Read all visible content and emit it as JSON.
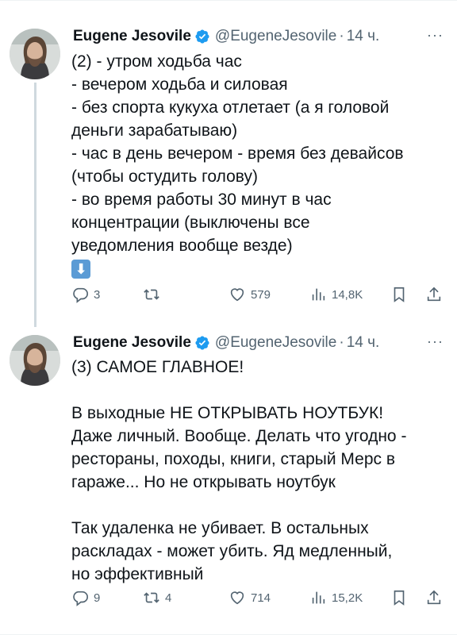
{
  "tweets": [
    {
      "author": {
        "name": "Eugene Jesovile",
        "handle": "@EugeneJesovile",
        "time": "14 ч."
      },
      "lines": [
        "(2) - утром ходьба час",
        "- вечером ходьба и силовая",
        "- без спорта кукуха отлетает (а я головой",
        "деньги зарабатываю)",
        "- час в день вечером - время без девайсов",
        "(чтобы остудить голову)",
        "- во время работы 30 минут в час",
        "концентрации (выключены все",
        "уведомления вообще везде)"
      ],
      "emoji": "⬇",
      "stats": {
        "replies": "3",
        "retweets": "",
        "likes": "579",
        "views": "14,8K"
      }
    },
    {
      "author": {
        "name": "Eugene Jesovile",
        "handle": "@EugeneJesovile",
        "time": "14 ч."
      },
      "lines": [
        "(3) САМОЕ ГЛАВНОЕ!",
        "",
        "В выходные НЕ ОТКРЫВАТЬ НОУТБУК!",
        "Даже личный. Вообще. Делать что угодно -",
        "рестораны, походы, книги, старый Мерс в",
        "гараже... Но не открывать ноутбук",
        "",
        "Так удаленка не убивает. В остальных",
        "раскладах - может убить. Яд медленный,",
        "но эффективный"
      ],
      "stats": {
        "replies": "9",
        "retweets": "4",
        "likes": "714",
        "views": "15,2K"
      }
    }
  ],
  "icons": {
    "verified": "verified-badge-icon",
    "reply": "reply-icon",
    "retweet": "retweet-icon",
    "like": "heart-icon",
    "views": "views-icon",
    "bookmark": "bookmark-icon",
    "share": "share-icon",
    "more": "more-icon"
  },
  "colors": {
    "verified": "#1d9bf0",
    "muted": "#536471",
    "text": "#0f1419",
    "line": "#cfd9de"
  }
}
